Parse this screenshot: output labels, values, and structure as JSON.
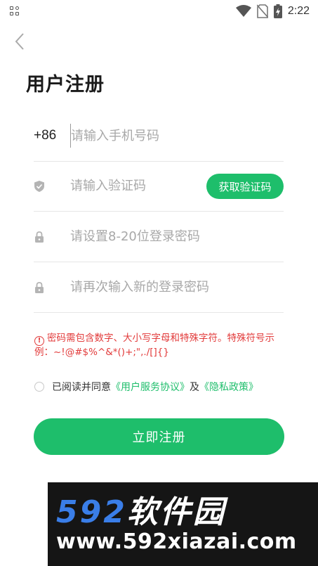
{
  "status_bar": {
    "time": "2:22"
  },
  "title": "用户注册",
  "form": {
    "phone_prefix": "+86",
    "phone_placeholder": "请输入手机号码",
    "code_placeholder": "请输入验证码",
    "get_code_label": "获取验证码",
    "password_placeholder": "请设置8-20位登录密码",
    "password_confirm_placeholder": "请再次输入新的登录密码"
  },
  "notice": {
    "icon": "!",
    "text": "密码需包含数字、大小写字母和特殊字符。特殊符号示例：~!@#$%^&*()+;\",./[]{}"
  },
  "agreement": {
    "prefix": "已阅读并同意",
    "service_link": "《用户服务协议》",
    "and": "及",
    "privacy_link": "《隐私政策》"
  },
  "register_label": "立即注册",
  "watermark": {
    "brand_num": "592",
    "brand_cn": "软件园",
    "url": "www.592xiazai.com"
  },
  "colors": {
    "accent": "#1ebe6b",
    "warning": "#e23b3b"
  }
}
